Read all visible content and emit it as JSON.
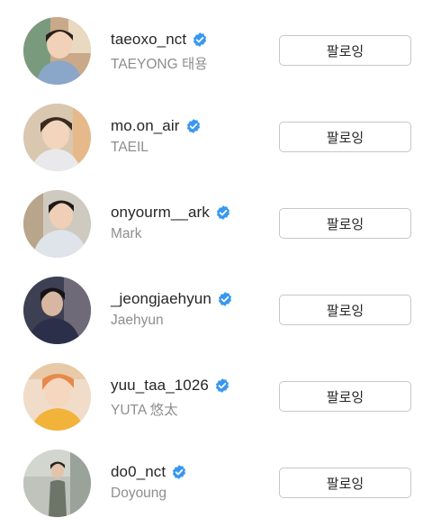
{
  "colors": {
    "verified_badge": "#3897f0",
    "username_text": "#262626",
    "fullname_text": "#8e8e8e",
    "button_border": "#c7c7c7"
  },
  "icons": {
    "verified": "verified-badge-icon"
  },
  "following_list": [
    {
      "username": "taeoxo_nct",
      "full_name": "TAEYONG 태용",
      "verified": true,
      "button_label": "팔로잉"
    },
    {
      "username": "mo.on_air",
      "full_name": "TAEIL",
      "verified": true,
      "button_label": "팔로잉"
    },
    {
      "username": "onyourm__ark",
      "full_name": "Mark",
      "verified": true,
      "button_label": "팔로잉"
    },
    {
      "username": "_jeongjaehyun",
      "full_name": "Jaehyun",
      "verified": true,
      "button_label": "팔로잉"
    },
    {
      "username": "yuu_taa_1026",
      "full_name": "YUTA 悠太",
      "verified": true,
      "button_label": "팔로잉"
    },
    {
      "username": "do0_nct",
      "full_name": "Doyoung",
      "verified": true,
      "button_label": "팔로잉"
    }
  ]
}
